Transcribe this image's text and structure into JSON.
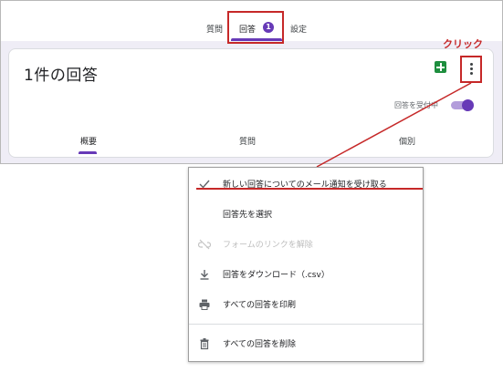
{
  "tabs": {
    "questions": "質問",
    "responses": "回答",
    "responses_badge": "1",
    "settings": "設定"
  },
  "annotation": {
    "click_label": "クリック"
  },
  "summary": {
    "title": "1件の回答",
    "accepting_label": "回答を受付中",
    "accepting_on": true
  },
  "subtabs": {
    "summary": "概要",
    "question": "質問",
    "individual": "個別"
  },
  "menu": {
    "items": [
      {
        "label": "新しい回答についてのメール通知を受け取る",
        "icon": "check-icon",
        "enabled": true
      },
      {
        "label": "回答先を選択",
        "icon": "",
        "enabled": true
      },
      {
        "label": "フォームのリンクを解除",
        "icon": "unlink-icon",
        "enabled": false
      },
      {
        "label": "回答をダウンロード（.csv）",
        "icon": "download-icon",
        "enabled": true
      },
      {
        "label": "すべての回答を印刷",
        "icon": "print-icon",
        "enabled": true
      },
      {
        "label": "すべての回答を削除",
        "icon": "trash-icon",
        "enabled": true
      }
    ]
  },
  "colors": {
    "accent": "#673ab7",
    "annotation_red": "#c62828",
    "sheets_green": "#1e8e3e"
  }
}
